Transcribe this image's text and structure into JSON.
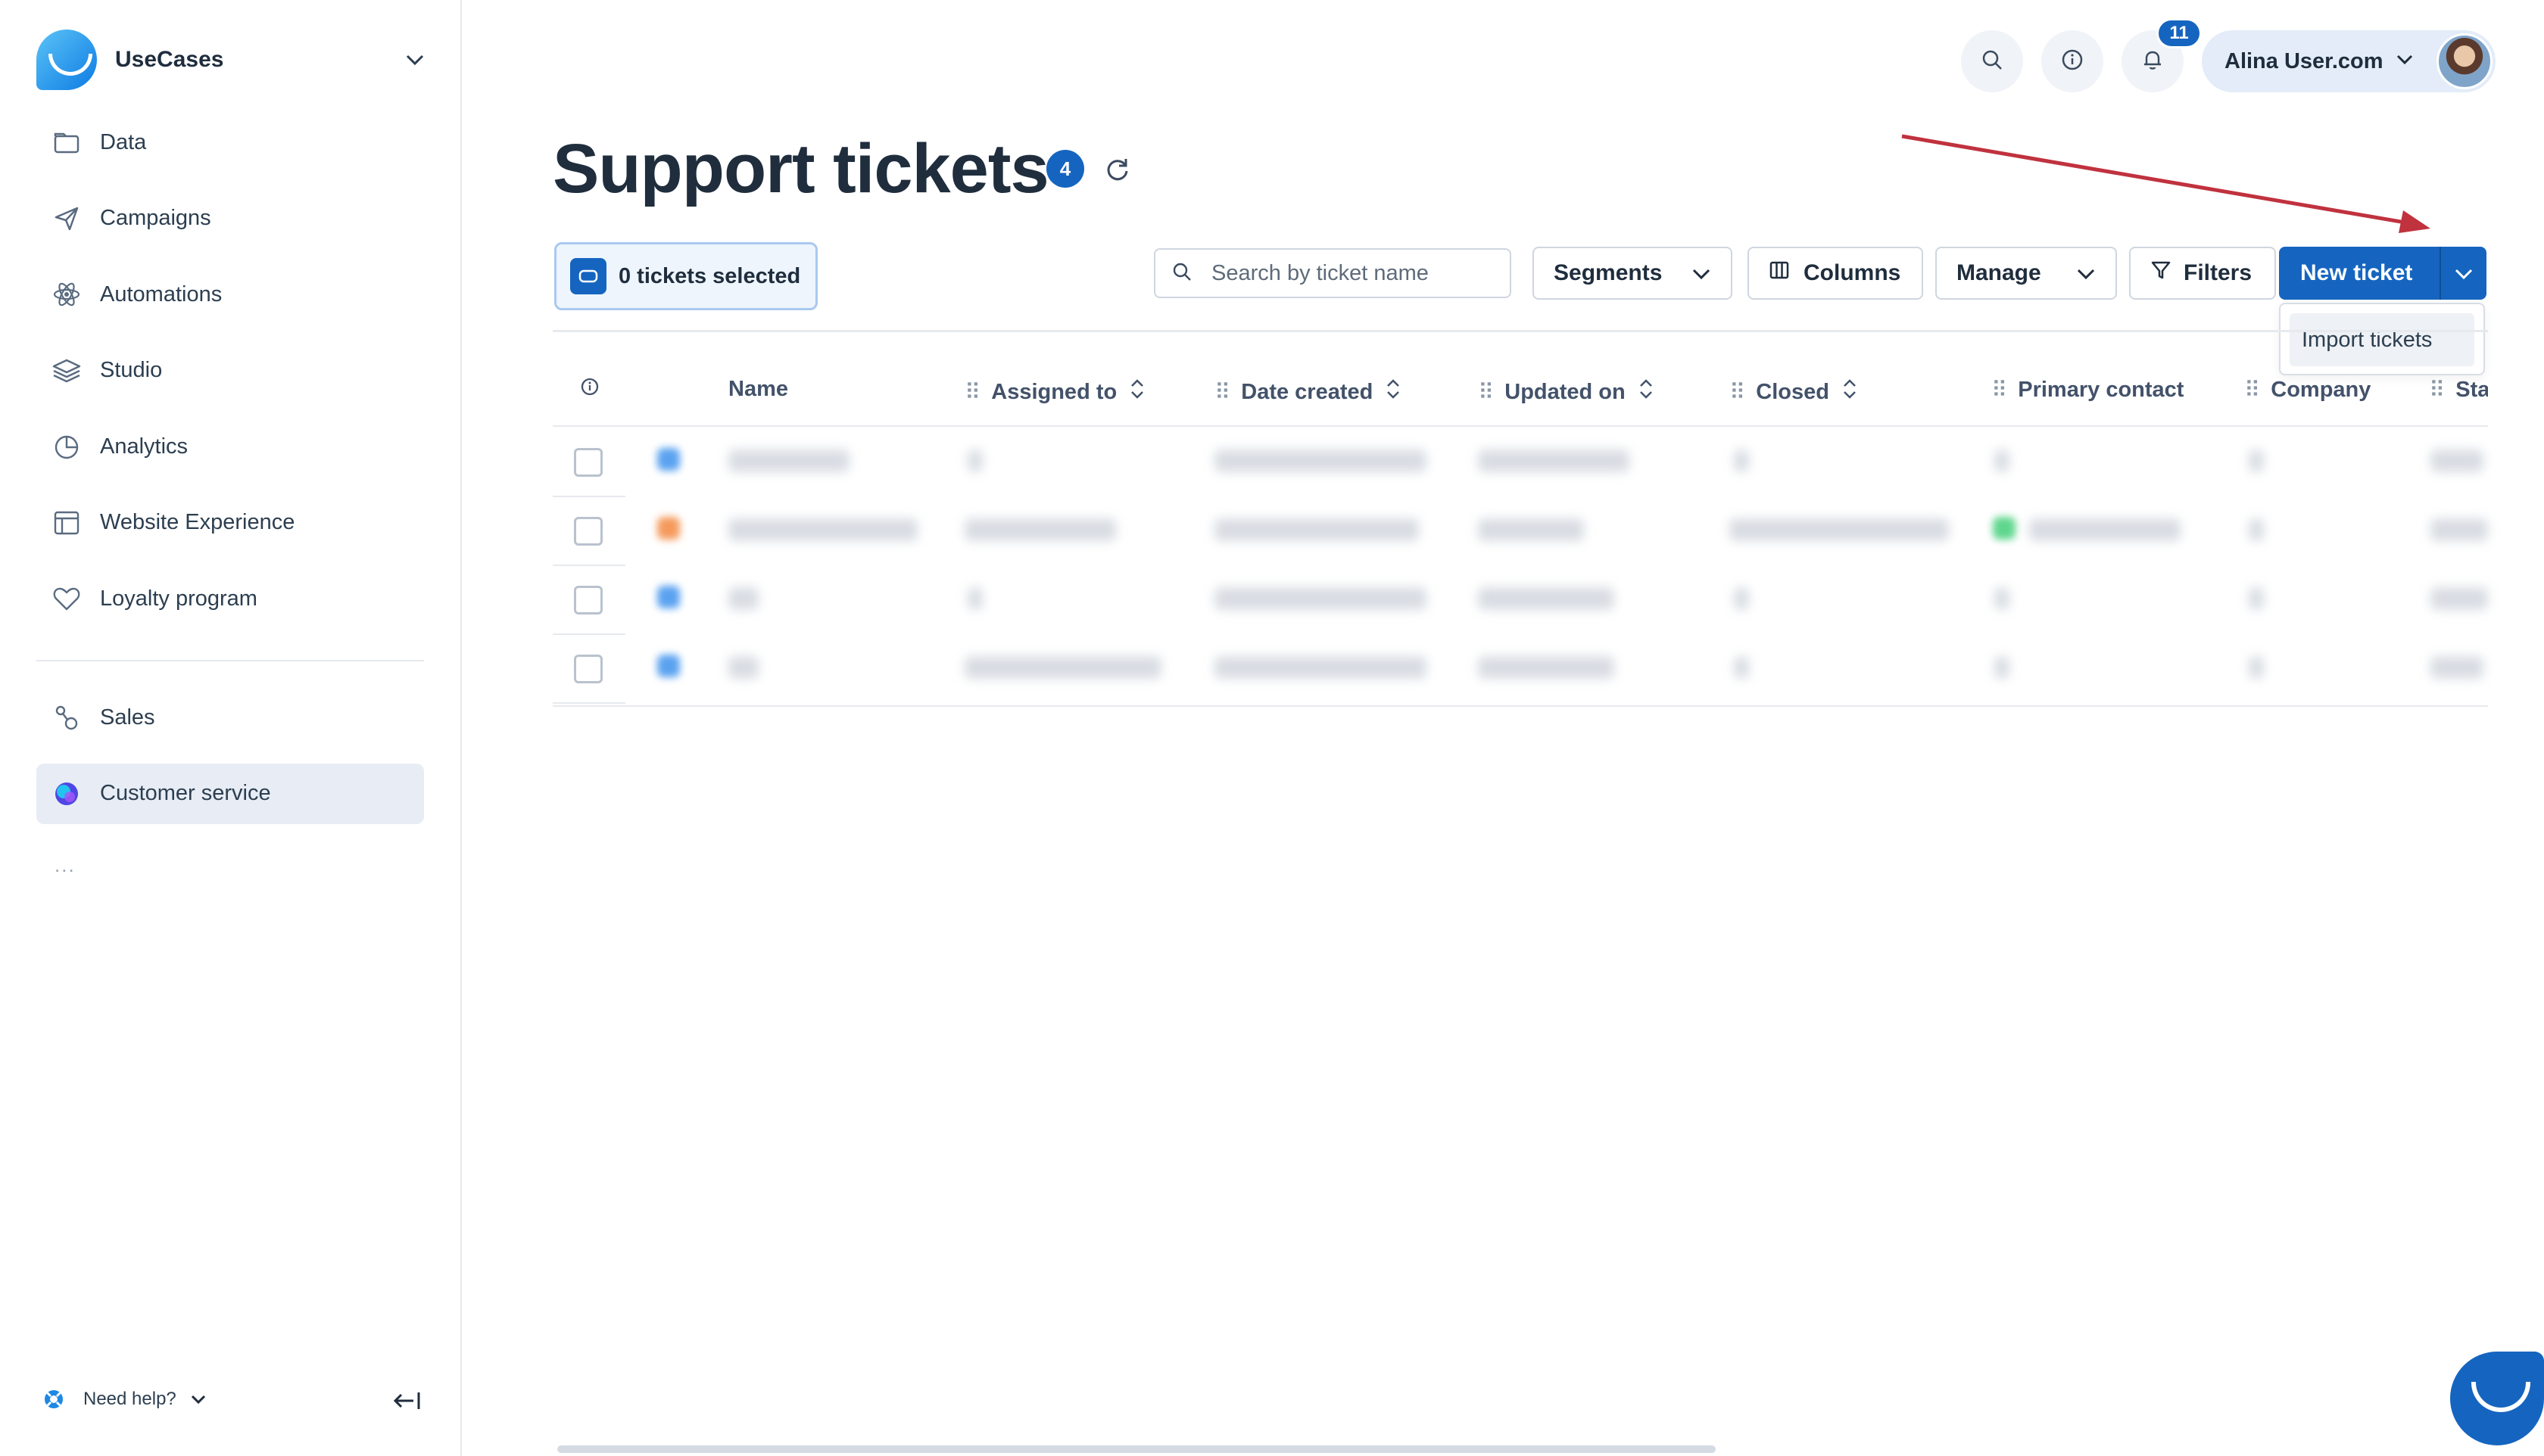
{
  "brand": {
    "name": "UseCases"
  },
  "sidebar": {
    "items": [
      {
        "label": "Data",
        "icon": "folder-icon"
      },
      {
        "label": "Campaigns",
        "icon": "paper-plane-icon"
      },
      {
        "label": "Automations",
        "icon": "atom-icon"
      },
      {
        "label": "Studio",
        "icon": "layers-icon"
      },
      {
        "label": "Analytics",
        "icon": "pie-chart-icon"
      },
      {
        "label": "Website Experience",
        "icon": "browser-window-icon"
      },
      {
        "label": "Loyalty program",
        "icon": "heart-badge-icon"
      }
    ],
    "items2": [
      {
        "label": "Sales",
        "icon": "sales-funnel-icon"
      },
      {
        "label": "Customer service",
        "icon": "customer-service-icon",
        "active": true
      }
    ],
    "more": "...",
    "help_label": "Need help?"
  },
  "topbar": {
    "notifications_count": "11",
    "user_name": "Alina User.com"
  },
  "page": {
    "title": "Support tickets",
    "ticket_count": "4"
  },
  "toolbar": {
    "selected_label": "0 tickets selected",
    "search_placeholder": "Search by ticket name",
    "segments_label": "Segments",
    "columns_label": "Columns",
    "manage_label": "Manage",
    "filters_label": "Filters",
    "new_ticket_label": "New ticket",
    "dropdown_item": "Import tickets"
  },
  "table": {
    "columns": [
      "Name",
      "Assigned to",
      "Date created",
      "Updated on",
      "Closed",
      "Primary contact",
      "Company",
      "Sta"
    ],
    "row_count": 4
  },
  "colors": {
    "primary": "#1565c0",
    "arrow": "#c0323e"
  }
}
